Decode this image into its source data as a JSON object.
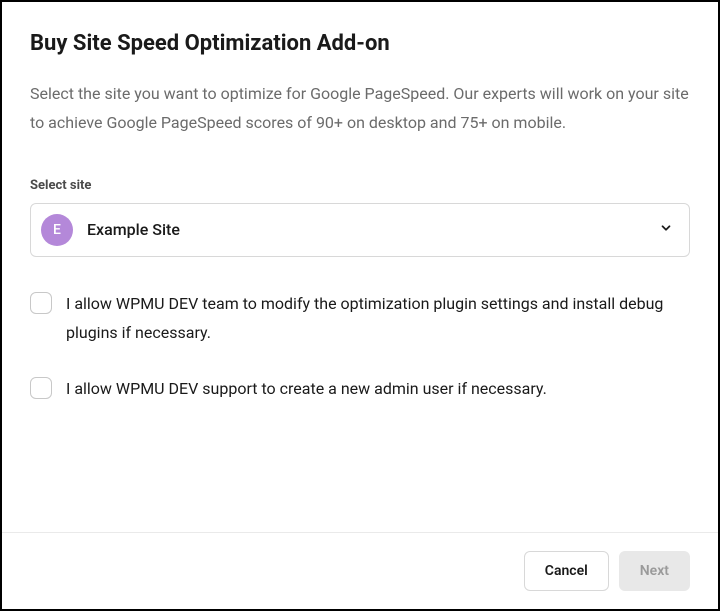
{
  "modal": {
    "title": "Buy Site Speed Optimization Add-on",
    "description": "Select the site you want to optimize for Google PageSpeed. Our experts will work on your site to achieve Google PageSpeed scores of 90+ on desktop and 75+ on mobile."
  },
  "site_select": {
    "label": "Select site",
    "avatar_letter": "E",
    "selected": "Example Site"
  },
  "consents": [
    {
      "label": "I allow WPMU DEV team to modify the optimization plugin settings and install debug plugins if necessary."
    },
    {
      "label": "I allow WPMU DEV support to create a new admin user if necessary."
    }
  ],
  "footer": {
    "cancel": "Cancel",
    "next": "Next"
  }
}
